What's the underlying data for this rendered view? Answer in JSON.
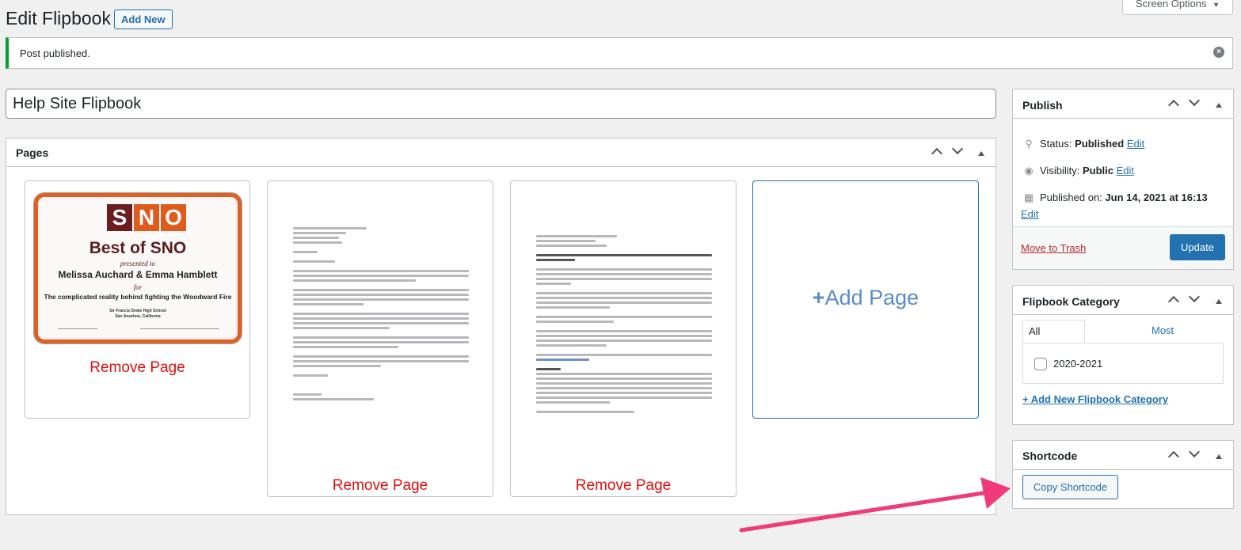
{
  "header": {
    "title": "Edit Flipbook",
    "add_new": "Add New",
    "screen_options": "Screen Options"
  },
  "notice": {
    "text": "Post published."
  },
  "post": {
    "title": "Help Site Flipbook"
  },
  "pages_box": {
    "title": "Pages",
    "remove_label": "Remove Page",
    "add_label": "Add Page",
    "certificate": {
      "letters": [
        "S",
        "N",
        "O"
      ],
      "heading": "Best of SNO",
      "presented": "presented to",
      "names": "Melissa Auchard & Emma Hamblett",
      "for": "for",
      "story": "The complicated reality behind fighting the Woodward Fire",
      "school": "Sir Francis Drake High School",
      "location": "San Anselmo, California"
    }
  },
  "publish_box": {
    "title": "Publish",
    "status_label": "Status:",
    "status_value": "Published",
    "visibility_label": "Visibility:",
    "visibility_value": "Public",
    "published_label": "Published on:",
    "published_value": "Jun 14, 2021 at 16:13",
    "edit": "Edit",
    "trash": "Move to Trash",
    "update": "Update"
  },
  "category_box": {
    "title": "Flipbook Category",
    "tab_all": "All Flipbook Categories",
    "tab_used": "Most Used",
    "items": [
      "2020-2021"
    ],
    "add_new": "+ Add New Flipbook Category"
  },
  "shortcode_box": {
    "title": "Shortcode",
    "copy": "Copy Shortcode"
  },
  "colors": {
    "accent": "#2271b1",
    "success": "#00a32a",
    "remove": "#e0100f",
    "arrow": "#f03a7a"
  }
}
